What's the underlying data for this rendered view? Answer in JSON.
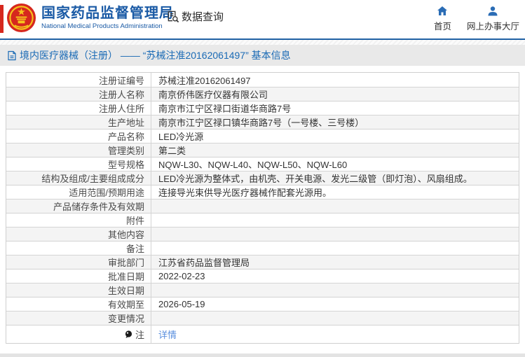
{
  "header": {
    "logo_title": "国家药品监督管理局",
    "logo_subtitle": "National Medical Products Administration",
    "data_query_label": "数据查询",
    "nav": [
      {
        "label": "首页",
        "icon": "home-icon"
      },
      {
        "label": "网上办事大厅",
        "icon": "person-icon"
      }
    ]
  },
  "breadcrumb": {
    "icon": "document-icon",
    "text": "境内医疗器械（注册） —— “苏械注准20162061497” 基本信息"
  },
  "table": {
    "rows": [
      {
        "label": "注册证编号",
        "value": "苏械注准20162061497"
      },
      {
        "label": "注册人名称",
        "value": "南京侨伟医疗仪器有限公司"
      },
      {
        "label": "注册人住所",
        "value": "南京市江宁区禄口街道华商路7号"
      },
      {
        "label": "生产地址",
        "value": "南京市江宁区禄口镇华商路7号（一号楼、三号楼）"
      },
      {
        "label": "产品名称",
        "value": "LED冷光源"
      },
      {
        "label": "管理类别",
        "value": "第二类"
      },
      {
        "label": "型号规格",
        "value": "NQW-L30、NQW-L40、NQW-L50、NQW-L60"
      },
      {
        "label": "结构及组成/主要组成成分",
        "value": "LED冷光源为整体式，由机壳、开关电源、发光二级管（即灯泡）、风扇组成。"
      },
      {
        "label": "适用范围/预期用途",
        "value": "连接导光束供导光医疗器械作配套光源用。"
      },
      {
        "label": "产品储存条件及有效期",
        "value": ""
      },
      {
        "label": "附件",
        "value": ""
      },
      {
        "label": "其他内容",
        "value": ""
      },
      {
        "label": "备注",
        "value": ""
      },
      {
        "label": "审批部门",
        "value": "江苏省药品监督管理局"
      },
      {
        "label": "批准日期",
        "value": "2022-02-23"
      },
      {
        "label": "生效日期",
        "value": ""
      },
      {
        "label": "有效期至",
        "value": "2026-05-19"
      },
      {
        "label": "变更情况",
        "value": ""
      },
      {
        "label": "注",
        "value": "详情",
        "note_icon": true,
        "link": true,
        "tall": true
      }
    ]
  },
  "colors": {
    "accent_blue": "#1a5aa5",
    "nav_icon_blue": "#2a6cb5",
    "breadcrumb_text": "#1a6ab5",
    "link_blue": "#5b8fde",
    "row_alt_bg": "#f4f4f4",
    "table_border": "#d4d4d4",
    "bar_bg": "#e9e9e9",
    "emblem_red": "#d6281e",
    "emblem_gold": "#f6c51d"
  },
  "icons": {
    "note_icon": "●",
    "dash": "——"
  }
}
